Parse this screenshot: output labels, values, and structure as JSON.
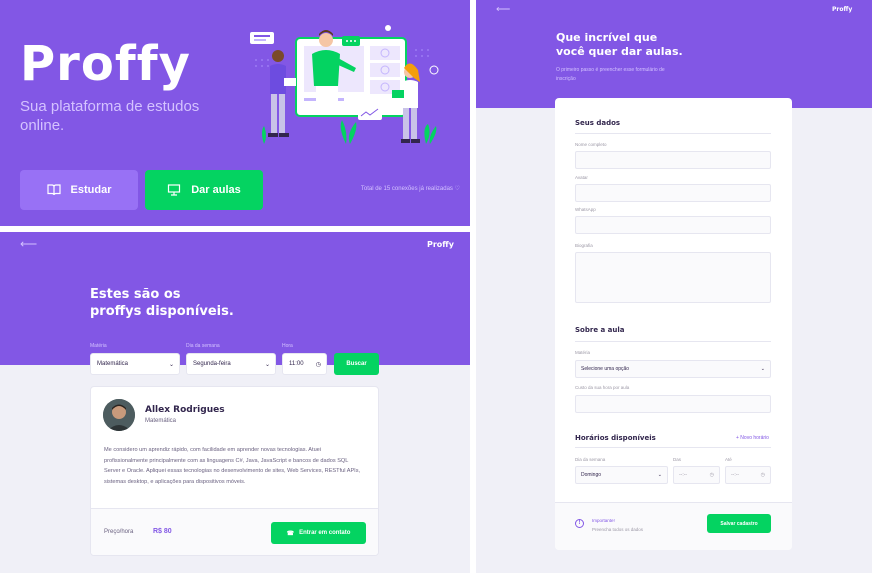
{
  "landing": {
    "logo": "Proffy",
    "tagline": "Sua plataforma de estudos online.",
    "study_label": "Estudar",
    "give_label": "Dar aulas",
    "connections": "Total de 15 conexões já realizadas"
  },
  "list_page": {
    "header_logo": "Proffy",
    "title_line1": "Estes são os",
    "title_line2": "proffys disponíveis.",
    "filters": {
      "subject_label": "Matéria",
      "subject_value": "Matemática",
      "weekday_label": "Dia da semana",
      "weekday_value": "Segunda-feira",
      "time_label": "Hora",
      "time_value": "11:00",
      "search_label": "Buscar"
    },
    "teacher": {
      "name": "Allex Rodrigues",
      "subject": "Matemática",
      "bio": "Me considero um aprendiz rápido, com facilidade em aprender novas tecnologias. Atuei profissionalmente principalmente com as linguagens C#, Java, JavaScript e bancos de dados SQL Server e Oracle. Apliquei essas tecnologias no desenvolvimento de sites, Web Services, RESTful APIs, sistemas desktop, e aplicações para dispositivos móveis.",
      "price_label": "Preço/hora",
      "price_value": "R$ 80",
      "contact_label": "Entrar em contato"
    }
  },
  "form_page": {
    "header_logo": "Proffy",
    "title_line1": "Que incrível que",
    "title_line2": "você quer dar aulas.",
    "subtitle": "O primeiro passo é preencher esse formulário de inscrição",
    "section_data": "Seus dados",
    "name_label": "Nome completo",
    "avatar_label": "Avatar",
    "whatsapp_label": "WhatsApp",
    "bio_label": "Biografia",
    "section_class": "Sobre a aula",
    "subject_label": "Matéria",
    "subject_placeholder": "Selecione uma opção",
    "cost_label": "Custo da sua hora por aula",
    "section_schedule": "Horários disponíveis",
    "new_time": "+ Novo horário",
    "weekday_label": "Dia da semana",
    "weekday_value": "Domingo",
    "from_label": "Das",
    "from_value": "--:--",
    "to_label": "Até",
    "to_value": "--:--",
    "warning_title": "Importante!",
    "warning_text": "Preencha todos os dados",
    "save_label": "Salvar cadastro"
  },
  "colors": {
    "primary": "#8257e5",
    "primary_light": "#9871f5",
    "secondary": "#04d361",
    "background": "#f0f0f7",
    "text_title": "#32264d"
  }
}
